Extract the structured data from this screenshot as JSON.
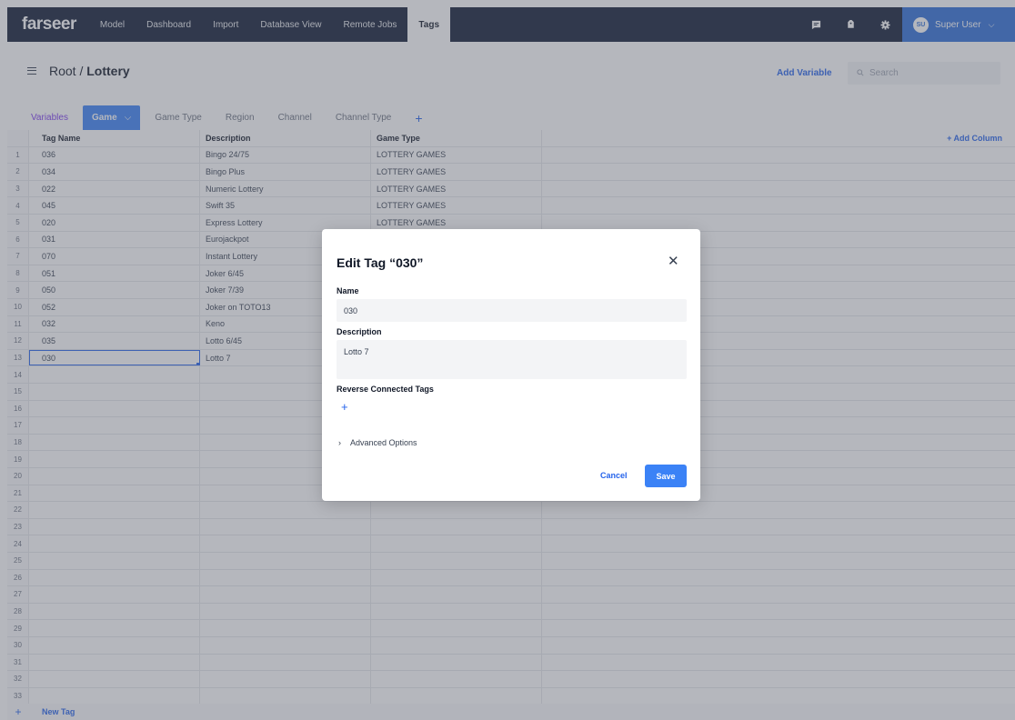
{
  "nav": {
    "logo": "farseer",
    "items": [
      "Model",
      "Dashboard",
      "Import",
      "Database View",
      "Remote Jobs",
      "Tags"
    ],
    "active": "Tags",
    "user": {
      "initials": "SU",
      "name": "Super User"
    }
  },
  "header": {
    "root": "Root / ",
    "current": "Lottery",
    "add_variable": "Add Variable",
    "search_placeholder": "Search"
  },
  "tabs": [
    "Variables",
    "Game",
    "Game Type",
    "Region",
    "Channel",
    "Channel Type"
  ],
  "active_tab": "Game",
  "table": {
    "headers": [
      "Tag Name",
      "Description",
      "Game Type"
    ],
    "add_column": "+ Add Column",
    "rows": [
      [
        "036",
        "Bingo 24/75",
        "LOTTERY GAMES"
      ],
      [
        "034",
        "Bingo Plus",
        "LOTTERY GAMES"
      ],
      [
        "022",
        "Numeric Lottery",
        "LOTTERY GAMES"
      ],
      [
        "045",
        "Swift 35",
        "LOTTERY GAMES"
      ],
      [
        "020",
        "Express Lottery",
        "LOTTERY GAMES"
      ],
      [
        "031",
        "Eurojackpot",
        ""
      ],
      [
        "070",
        "Instant Lottery",
        ""
      ],
      [
        "051",
        "Joker 6/45",
        ""
      ],
      [
        "050",
        "Joker 7/39",
        ""
      ],
      [
        "052",
        "Joker on TOTO13",
        ""
      ],
      [
        "032",
        "Keno",
        ""
      ],
      [
        "035",
        "Lotto 6/45",
        ""
      ],
      [
        "030",
        "Lotto 7",
        ""
      ]
    ],
    "row_count": 33,
    "new_tag": "New Tag"
  },
  "modal": {
    "title": "Edit Tag “030”",
    "name_label": "Name",
    "name_value": "030",
    "description_label": "Description",
    "description_value": "Lotto 7",
    "reverse_label": "Reverse Connected Tags",
    "advanced": "Advanced Options",
    "cancel": "Cancel",
    "save": "Save"
  },
  "colors": {
    "nav_bg": "#0f1b33",
    "accent": "#3b82f6",
    "link": "#2563eb"
  },
  "icons": [
    "comment-icon",
    "tag-icon",
    "gear-icon",
    "close-icon",
    "chevron-right-icon",
    "plus-icon",
    "search-icon",
    "menu-icon"
  ]
}
